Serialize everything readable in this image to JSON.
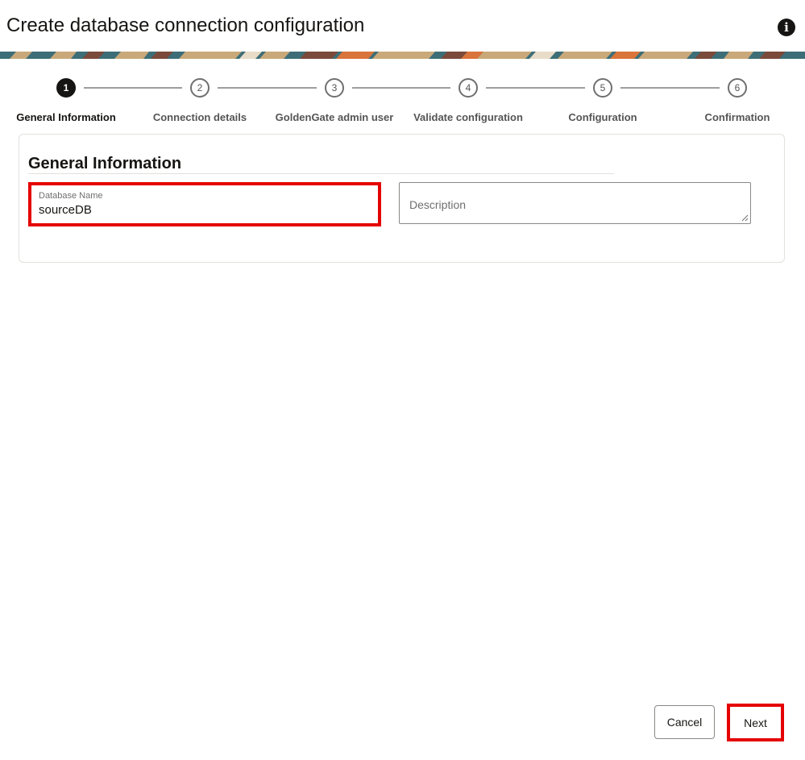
{
  "header": {
    "title": "Create database connection configuration",
    "info_icon": "info-icon"
  },
  "train": {
    "steps": [
      {
        "number": "1",
        "label": "General Information",
        "active": true
      },
      {
        "number": "2",
        "label": "Connection details",
        "active": false
      },
      {
        "number": "3",
        "label": "GoldenGate admin user",
        "active": false
      },
      {
        "number": "4",
        "label": "Validate configuration",
        "active": false
      },
      {
        "number": "5",
        "label": "Configuration",
        "active": false
      },
      {
        "number": "6",
        "label": "Confirmation",
        "active": false
      }
    ]
  },
  "form": {
    "section_title": "General Information",
    "database_name": {
      "label": "Database Name",
      "value": "sourceDB"
    },
    "description": {
      "placeholder": "Description",
      "value": ""
    }
  },
  "footer": {
    "cancel_label": "Cancel",
    "next_label": "Next"
  },
  "colors": {
    "highlight": "#e50000",
    "active_step": "#161513",
    "banner_teal": "#3d6e78",
    "banner_tan": "#c9a97a",
    "banner_brown": "#7a4a3a",
    "banner_orange": "#d9743a"
  }
}
